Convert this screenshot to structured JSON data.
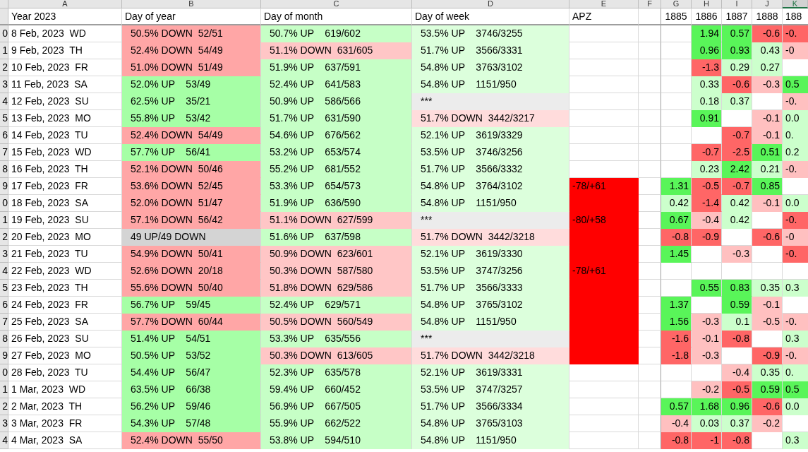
{
  "column_letters": [
    {
      "text": "A",
      "selected": false
    },
    {
      "text": "B",
      "selected": false
    },
    {
      "text": "C",
      "selected": false
    },
    {
      "text": "D",
      "selected": false
    },
    {
      "text": "E",
      "selected": false
    },
    {
      "text": "F",
      "selected": false
    },
    {
      "text": "G",
      "selected": false
    },
    {
      "text": "H",
      "selected": false
    },
    {
      "text": "I",
      "selected": false
    },
    {
      "text": "J",
      "selected": false
    },
    {
      "text": "K",
      "selected": true
    }
  ],
  "header": {
    "year": "Year 2023",
    "day_of_year": "Day of year",
    "day_of_month": "Day of month",
    "day_of_week": "Day of week",
    "apz": "APZ",
    "years": [
      "1885",
      "1886",
      "1887",
      "1888",
      "188"
    ]
  },
  "rows": [
    {
      "row_number": "0",
      "date": "8 Feb, 2023  WD",
      "day_of_year": {
        "text": "50.5% DOWN  52/51",
        "color": "#ffa6a6"
      },
      "day_of_month": {
        "text": "50.7% UP    619/602",
        "color": "#c6ffc6"
      },
      "day_of_week": {
        "text": "53.5% UP    3746/3255",
        "color": "#dcffdc"
      },
      "values": {
        "h": {
          "text": "1.94",
          "color": "#59f559"
        },
        "i": {
          "text": "0.57",
          "color": "#59f559"
        },
        "j": {
          "text": "-0.6",
          "color": "#ff6666"
        },
        "k": {
          "text": "-0.",
          "color": "#ff6666"
        }
      }
    },
    {
      "row_number": "1",
      "date": "9 Feb, 2023  TH",
      "day_of_year": {
        "text": "52.4% DOWN  54/49",
        "color": "#ffa6a6"
      },
      "day_of_month": {
        "text": "51.1% DOWN  631/605",
        "color": "#ffc6c6"
      },
      "day_of_week": {
        "text": "51.7% UP    3566/3331",
        "color": "#dcffdc"
      },
      "values": {
        "h": {
          "text": "0.96",
          "color": "#59f559"
        },
        "i": {
          "text": "0.93",
          "color": "#59f559"
        },
        "j": {
          "text": "0.43",
          "color": "#ccffcc"
        },
        "k": {
          "text": "-0",
          "color": "#ffc0c0"
        }
      }
    },
    {
      "row_number": "2",
      "date": "10 Feb, 2023  FR",
      "day_of_year": {
        "text": "51.0% DOWN  51/49",
        "color": "#ffa6a6"
      },
      "day_of_month": {
        "text": "51.9% UP    637/591",
        "color": "#c6ffc6"
      },
      "day_of_week": {
        "text": "54.8% UP    3763/3102",
        "color": "#dcffdc"
      },
      "values": {
        "h": {
          "text": "-1.3",
          "color": "#ff6666"
        },
        "i": {
          "text": "0.29",
          "color": "#ccffcc"
        },
        "j": {
          "text": "0.27",
          "color": "#ccffcc"
        }
      }
    },
    {
      "row_number": "3",
      "date": "11 Feb, 2023  SA",
      "day_of_year": {
        "text": "52.0% UP    53/49",
        "color": "#a6ffa6"
      },
      "day_of_month": {
        "text": "52.4% UP    641/583",
        "color": "#c6ffc6"
      },
      "day_of_week": {
        "text": "54.8% UP    1151/950",
        "color": "#dcffdc"
      },
      "values": {
        "h": {
          "text": "0.33",
          "color": "#ccffcc"
        },
        "i": {
          "text": "-0.6",
          "color": "#ff6666"
        },
        "j": {
          "text": "-0.3",
          "color": "#ffc0c0"
        },
        "k": {
          "text": "0.5",
          "color": "#59f559"
        }
      }
    },
    {
      "row_number": "4",
      "date": "12 Feb, 2023  SU",
      "day_of_year": {
        "text": "62.5% UP    35/21",
        "color": "#a6ffa6"
      },
      "day_of_month": {
        "text": "50.9% UP    586/566",
        "color": "#c6ffc6"
      },
      "day_of_week": {
        "text": "***",
        "color": "#ececec"
      },
      "values": {
        "h": {
          "text": "0.18",
          "color": "#ccffcc"
        },
        "i": {
          "text": "0.37",
          "color": "#ccffcc"
        },
        "k": {
          "text": "-0.",
          "color": "#ffc0c0"
        }
      }
    },
    {
      "row_number": "5",
      "date": "13 Feb, 2023  MO",
      "day_of_year": {
        "text": "55.8% UP    53/42",
        "color": "#a6ffa6"
      },
      "day_of_month": {
        "text": "51.7% UP    631/590",
        "color": "#c6ffc6"
      },
      "day_of_week": {
        "text": "51.7% DOWN  3442/3217",
        "color": "#ffdcdc"
      },
      "values": {
        "h": {
          "text": "0.91",
          "color": "#59f559"
        },
        "j": {
          "text": "-0.1",
          "color": "#ffc0c0"
        },
        "k": {
          "text": "0.0",
          "color": "#ccffcc"
        }
      }
    },
    {
      "row_number": "6",
      "date": "14 Feb, 2023  TU",
      "day_of_year": {
        "text": "52.4% DOWN  54/49",
        "color": "#ffa6a6"
      },
      "day_of_month": {
        "text": "54.6% UP    676/562",
        "color": "#c6ffc6"
      },
      "day_of_week": {
        "text": "52.1% UP    3619/3329",
        "color": "#dcffdc"
      },
      "values": {
        "i": {
          "text": "-0.7",
          "color": "#ff6666"
        },
        "j": {
          "text": "-0.1",
          "color": "#ffc0c0"
        },
        "k": {
          "text": "0.",
          "color": "#ccffcc"
        }
      }
    },
    {
      "row_number": "7",
      "date": "15 Feb, 2023  WD",
      "day_of_year": {
        "text": "57.7% UP    56/41",
        "color": "#a6ffa6"
      },
      "day_of_month": {
        "text": "53.2% UP    653/574",
        "color": "#c6ffc6"
      },
      "day_of_week": {
        "text": "53.5% UP    3746/3256",
        "color": "#dcffdc"
      },
      "values": {
        "h": {
          "text": "-0.7",
          "color": "#ff6666"
        },
        "i": {
          "text": "-2.5",
          "color": "#ff6666"
        },
        "j": {
          "text": "0.51",
          "color": "#59f559"
        },
        "k": {
          "text": "0.2",
          "color": "#ccffcc"
        }
      }
    },
    {
      "row_number": "8",
      "date": "16 Feb, 2023  TH",
      "day_of_year": {
        "text": "52.1% DOWN  50/46",
        "color": "#ffa6a6"
      },
      "day_of_month": {
        "text": "55.2% UP    681/552",
        "color": "#c6ffc6"
      },
      "day_of_week": {
        "text": "51.7% UP    3566/3332",
        "color": "#dcffdc"
      },
      "values": {
        "h": {
          "text": "0.23",
          "color": "#ccffcc"
        },
        "i": {
          "text": "2.42",
          "color": "#59f559"
        },
        "j": {
          "text": "0.21",
          "color": "#ccffcc"
        },
        "k": {
          "text": "-0.",
          "color": "#ffc0c0"
        }
      }
    },
    {
      "row_number": "9",
      "date": "17 Feb, 2023  FR",
      "day_of_year": {
        "text": "53.6% DOWN  52/45",
        "color": "#ffa6a6"
      },
      "day_of_month": {
        "text": "53.3% UP    654/573",
        "color": "#c6ffc6"
      },
      "day_of_week": {
        "text": "54.8% UP    3764/3102",
        "color": "#dcffdc"
      },
      "apz": {
        "text": "-78/+61",
        "color": "#ff0000"
      },
      "values": {
        "g": {
          "text": "1.31",
          "color": "#59f559"
        },
        "h": {
          "text": "-0.5",
          "color": "#ff6666"
        },
        "i": {
          "text": "-0.7",
          "color": "#ff6666"
        },
        "j": {
          "text": "0.85",
          "color": "#59f559"
        }
      }
    },
    {
      "row_number": "0",
      "date": "18 Feb, 2023  SA",
      "day_of_year": {
        "text": "52.0% DOWN  51/47",
        "color": "#ffa6a6"
      },
      "day_of_month": {
        "text": "51.9% UP    636/590",
        "color": "#c6ffc6"
      },
      "day_of_week": {
        "text": "54.8% UP    1151/950",
        "color": "#dcffdc"
      },
      "apz": {
        "color": "#ff0000"
      },
      "values": {
        "g": {
          "text": "0.42",
          "color": "#ccffcc"
        },
        "h": {
          "text": "-1.4",
          "color": "#ff6666"
        },
        "i": {
          "text": "0.42",
          "color": "#ccffcc"
        },
        "j": {
          "text": "-0.1",
          "color": "#ffc0c0"
        },
        "k": {
          "text": "0.0",
          "color": "#ccffcc"
        }
      }
    },
    {
      "row_number": "1",
      "date": "19 Feb, 2023  SU",
      "day_of_year": {
        "text": "57.1% DOWN  56/42",
        "color": "#ffa6a6"
      },
      "day_of_month": {
        "text": "51.1% DOWN  627/599",
        "color": "#ffc6c6"
      },
      "day_of_week": {
        "text": "***",
        "color": "#ececec"
      },
      "apz": {
        "text": "-80/+58",
        "color": "#ff0000"
      },
      "values": {
        "g": {
          "text": "0.67",
          "color": "#59f559"
        },
        "h": {
          "text": "-0.4",
          "color": "#ffc0c0"
        },
        "i": {
          "text": "0.42",
          "color": "#ccffcc"
        },
        "k": {
          "text": "-0.",
          "color": "#ff6666"
        }
      }
    },
    {
      "row_number": "2",
      "date": "20 Feb, 2023  MO",
      "day_of_year": {
        "text": "49 UP/49 DOWN",
        "color": "#d4d4d4"
      },
      "day_of_month": {
        "text": "51.6% UP    637/598",
        "color": "#c6ffc6"
      },
      "day_of_week": {
        "text": "51.7% DOWN  3442/3218",
        "color": "#ffdcdc"
      },
      "apz": {
        "color": "#ff0000"
      },
      "values": {
        "g": {
          "text": "-0.8",
          "color": "#ff6666"
        },
        "h": {
          "text": "-0.9",
          "color": "#ff6666"
        },
        "j": {
          "text": "-0.6",
          "color": "#ff6666"
        },
        "k": {
          "text": "-0",
          "color": "#ffc0c0"
        }
      }
    },
    {
      "row_number": "3",
      "date": "21 Feb, 2023  TU",
      "day_of_year": {
        "text": "54.9% DOWN  50/41",
        "color": "#ffa6a6"
      },
      "day_of_month": {
        "text": "50.9% DOWN  623/601",
        "color": "#ffc6c6"
      },
      "day_of_week": {
        "text": "52.1% UP    3619/3330",
        "color": "#dcffdc"
      },
      "apz": {
        "color": "#ff0000"
      },
      "values": {
        "g": {
          "text": "1.45",
          "color": "#59f559"
        },
        "i": {
          "text": "-0.3",
          "color": "#ffc0c0"
        },
        "k": {
          "text": "-0.",
          "color": "#ff6666"
        }
      }
    },
    {
      "row_number": "4",
      "date": "22 Feb, 2023  WD",
      "day_of_year": {
        "text": "52.6% DOWN  20/18",
        "color": "#ffa6a6"
      },
      "day_of_month": {
        "text": "50.3% DOWN  587/580",
        "color": "#ffc6c6"
      },
      "day_of_week": {
        "text": "53.5% UP    3747/3256",
        "color": "#dcffdc"
      },
      "apz": {
        "text": "-78/+61",
        "color": "#ff0000"
      }
    },
    {
      "row_number": "5",
      "date": "23 Feb, 2023  TH",
      "day_of_year": {
        "text": "55.6% DOWN  50/40",
        "color": "#ffa6a6"
      },
      "day_of_month": {
        "text": "51.8% DOWN  629/586",
        "color": "#ffc6c6"
      },
      "day_of_week": {
        "text": "51.7% UP    3566/3333",
        "color": "#dcffdc"
      },
      "apz": {
        "color": "#ff0000"
      },
      "values": {
        "h": {
          "text": "0.55",
          "color": "#59f559"
        },
        "i": {
          "text": "0.83",
          "color": "#59f559"
        },
        "j": {
          "text": "0.35",
          "color": "#ccffcc"
        },
        "k": {
          "text": "0.3",
          "color": "#ccffcc"
        }
      }
    },
    {
      "row_number": "6",
      "date": "24 Feb, 2023  FR",
      "day_of_year": {
        "text": "56.7% UP    59/45",
        "color": "#a6ffa6"
      },
      "day_of_month": {
        "text": "52.4% UP    629/571",
        "color": "#c6ffc6"
      },
      "day_of_week": {
        "text": "54.8% UP    3765/3102",
        "color": "#dcffdc"
      },
      "apz": {
        "color": "#ff0000"
      },
      "values": {
        "g": {
          "text": "1.37",
          "color": "#59f559"
        },
        "i": {
          "text": "0.59",
          "color": "#59f559"
        },
        "j": {
          "text": "-0.1",
          "color": "#ffc0c0"
        }
      }
    },
    {
      "row_number": "7",
      "date": "25 Feb, 2023  SA",
      "day_of_year": {
        "text": "57.7% DOWN  60/44",
        "color": "#ffa6a6"
      },
      "day_of_month": {
        "text": "50.5% DOWN  560/549",
        "color": "#ffc6c6"
      },
      "day_of_week": {
        "text": "54.8% UP    1151/950",
        "color": "#dcffdc"
      },
      "apz": {
        "color": "#ff0000"
      },
      "values": {
        "g": {
          "text": "1.56",
          "color": "#59f559"
        },
        "h": {
          "text": "-0.3",
          "color": "#ffc0c0"
        },
        "i": {
          "text": "0.1",
          "color": "#ccffcc"
        },
        "j": {
          "text": "-0.5",
          "color": "#ffc0c0"
        },
        "k": {
          "text": "-0.",
          "color": "#ffc0c0"
        }
      }
    },
    {
      "row_number": "8",
      "date": "26 Feb, 2023  SU",
      "day_of_year": {
        "text": "51.4% UP    54/51",
        "color": "#a6ffa6"
      },
      "day_of_month": {
        "text": "53.3% UP    635/556",
        "color": "#c6ffc6"
      },
      "day_of_week": {
        "text": "***",
        "color": "#ececec"
      },
      "apz": {
        "color": "#ff0000"
      },
      "values": {
        "g": {
          "text": "-1.6",
          "color": "#ff6666"
        },
        "h": {
          "text": "-0.1",
          "color": "#ffc0c0"
        },
        "i": {
          "text": "-0.8",
          "color": "#ff6666"
        },
        "k": {
          "text": "0.3",
          "color": "#ccffcc"
        }
      }
    },
    {
      "row_number": "9",
      "date": "27 Feb, 2023  MO",
      "day_of_year": {
        "text": "50.5% UP    53/52",
        "color": "#a6ffa6"
      },
      "day_of_month": {
        "text": "50.3% DOWN  613/605",
        "color": "#ffc6c6"
      },
      "day_of_week": {
        "text": "51.7% DOWN  3442/3218",
        "color": "#ffdcdc"
      },
      "apz": {
        "color": "#ff0000"
      },
      "values": {
        "g": {
          "text": "-1.8",
          "color": "#ff6666"
        },
        "h": {
          "text": "-0.3",
          "color": "#ffc0c0"
        },
        "j": {
          "text": "-0.9",
          "color": "#ff6666"
        },
        "k": {
          "text": "-0.",
          "color": "#ffc0c0"
        }
      }
    },
    {
      "row_number": "0",
      "date": "28 Feb, 2023  TU",
      "day_of_year": {
        "text": "54.4% UP    56/47",
        "color": "#a6ffa6"
      },
      "day_of_month": {
        "text": "52.3% UP    635/578",
        "color": "#c6ffc6"
      },
      "day_of_week": {
        "text": "52.1% UP    3619/3331",
        "color": "#dcffdc"
      },
      "values": {
        "i": {
          "text": "-0.4",
          "color": "#ffc0c0"
        },
        "j": {
          "text": "0.35",
          "color": "#ccffcc"
        },
        "k": {
          "text": "0.",
          "color": "#ccffcc"
        }
      }
    },
    {
      "row_number": "1",
      "date": "1 Mar, 2023  WD",
      "day_of_year": {
        "text": "63.5% UP    66/38",
        "color": "#a6ffa6"
      },
      "day_of_month": {
        "text": "59.4% UP    660/452",
        "color": "#c6ffc6"
      },
      "day_of_week": {
        "text": "53.5% UP    3747/3257",
        "color": "#dcffdc"
      },
      "values": {
        "h": {
          "text": "-0.2",
          "color": "#ffc0c0"
        },
        "i": {
          "text": "-0.5",
          "color": "#ff6666"
        },
        "j": {
          "text": "0.59",
          "color": "#59f559"
        },
        "k": {
          "text": "0.5",
          "color": "#59f559"
        }
      }
    },
    {
      "row_number": "2",
      "date": "2 Mar, 2023  TH",
      "day_of_year": {
        "text": "56.2% UP    59/46",
        "color": "#a6ffa6"
      },
      "day_of_month": {
        "text": "56.9% UP    667/505",
        "color": "#c6ffc6"
      },
      "day_of_week": {
        "text": "51.7% UP    3566/3334",
        "color": "#dcffdc"
      },
      "values": {
        "g": {
          "text": "0.57",
          "color": "#59f559"
        },
        "h": {
          "text": "1.68",
          "color": "#59f559"
        },
        "i": {
          "text": "0.96",
          "color": "#59f559"
        },
        "j": {
          "text": "-0.6",
          "color": "#ff6666"
        },
        "k": {
          "text": "0.0",
          "color": "#ccffcc"
        }
      }
    },
    {
      "row_number": "3",
      "date": "3 Mar, 2023  FR",
      "day_of_year": {
        "text": "54.3% UP    57/48",
        "color": "#a6ffa6"
      },
      "day_of_month": {
        "text": "55.9% UP    662/522",
        "color": "#c6ffc6"
      },
      "day_of_week": {
        "text": "54.8% UP    3765/3103",
        "color": "#dcffdc"
      },
      "values": {
        "g": {
          "text": "-0.4",
          "color": "#ffc0c0"
        },
        "h": {
          "text": "0.03",
          "color": "#ccffcc"
        },
        "i": {
          "text": "0.37",
          "color": "#ccffcc"
        },
        "j": {
          "text": "-0.2",
          "color": "#ffc0c0"
        }
      }
    },
    {
      "row_number": "4",
      "date": "4 Mar, 2023  SA",
      "day_of_year": {
        "text": "52.4% DOWN  55/50",
        "color": "#ffa6a6"
      },
      "day_of_month": {
        "text": "53.8% UP    594/510",
        "color": "#c6ffc6"
      },
      "day_of_week": {
        "text": "54.8% UP    1151/950",
        "color": "#dcffdc"
      },
      "values": {
        "g": {
          "text": "-0.8",
          "color": "#ff6666"
        },
        "h": {
          "text": "-1",
          "color": "#ff6666"
        },
        "i": {
          "text": "-0.8",
          "color": "#ff6666"
        },
        "k": {
          "text": "0.3",
          "color": "#ccffcc"
        }
      }
    }
  ]
}
